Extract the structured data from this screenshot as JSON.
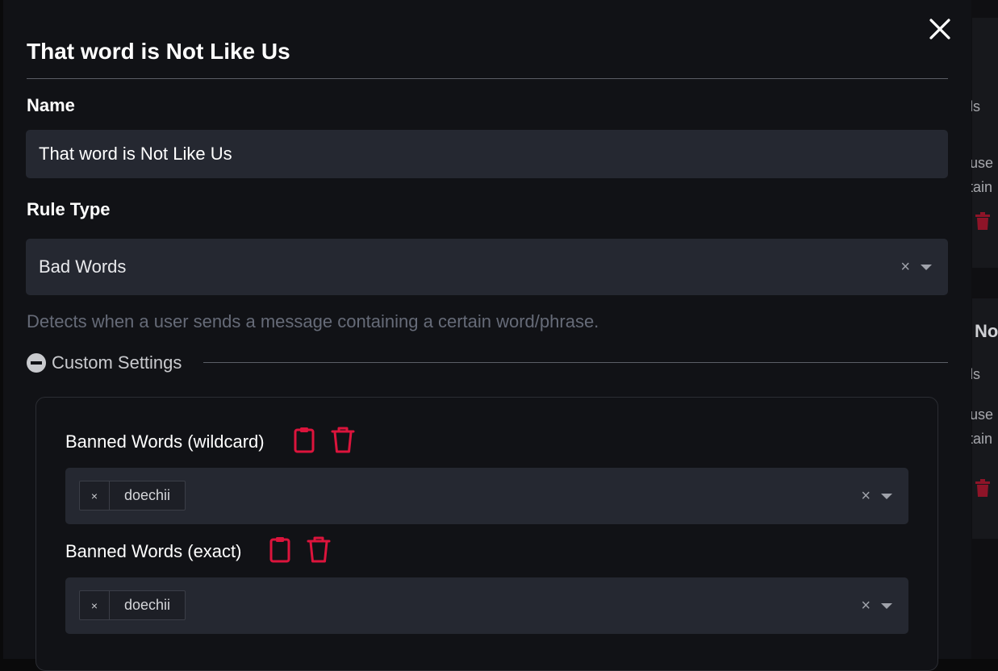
{
  "background": {
    "frag1": "ds",
    "frag2": "use",
    "frag3": "rtain",
    "frag4": "No",
    "frag5": "ds",
    "frag6": "use",
    "frag7": "rtain"
  },
  "modal": {
    "title": "That word is Not Like Us",
    "name_label": "Name",
    "name_value": "That word is Not Like Us",
    "rule_type_label": "Rule Type",
    "rule_type_value": "Bad Words",
    "rule_type_clear": "×",
    "rule_description": "Detects when a user sends a message containing a certain word/phrase.",
    "custom_settings_label": "Custom Settings"
  },
  "settings": {
    "wildcard": {
      "label": "Banned Words (wildcard)",
      "chip_remove": "×",
      "chips": [
        "doechii"
      ],
      "clear": "×"
    },
    "exact": {
      "label": "Banned Words (exact)",
      "chip_remove": "×",
      "chips": [
        "doechii"
      ],
      "clear": "×"
    }
  },
  "icons": {
    "close": "close-icon",
    "clipboard": "clipboard-icon",
    "trash": "trash-icon",
    "minus_circle": "minus-circle-icon",
    "caret": "chevron-down-icon"
  },
  "colors": {
    "accent_red": "#dc143c",
    "modal_bg": "#111216",
    "input_bg": "#252831",
    "muted_text": "#666b78"
  }
}
